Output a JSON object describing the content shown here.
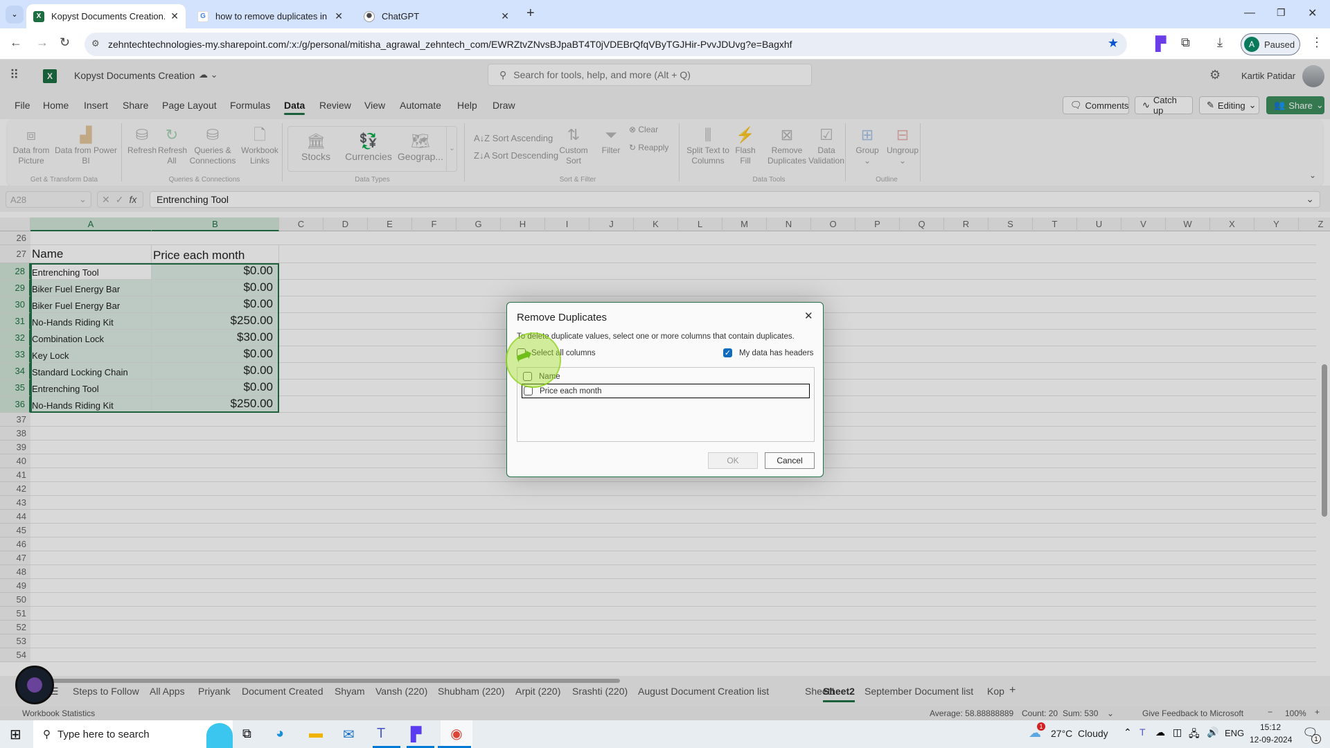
{
  "browser": {
    "tabs": [
      {
        "title": "Kopyst Documents Creation.xlsx",
        "icon": "excel-icon",
        "active": true
      },
      {
        "title": "how to remove duplicates in excel",
        "icon": "google-icon",
        "active": false
      },
      {
        "title": "ChatGPT",
        "icon": "chatgpt-icon",
        "active": false
      }
    ],
    "url": "zehntechtechnologies-my.sharepoint.com/:x:/g/personal/mitisha_agrawal_zehntech_com/EWRZtvZNvsBJpaBT4T0jVDEBrQfqVByTGJHir-PvvJDUvg?e=Bagxhf",
    "profile_label": "Paused",
    "profile_initial": "A"
  },
  "excel": {
    "doc_title": "Kopyst Documents Creation",
    "search_placeholder": "Search for tools, help, and more (Alt + Q)",
    "user_name": "Kartik Patidar",
    "menu": [
      "File",
      "Home",
      "Insert",
      "Share",
      "Page Layout",
      "Formulas",
      "Data",
      "Review",
      "View",
      "Automate",
      "Help",
      "Draw"
    ],
    "active_menu": "Data",
    "header_buttons": {
      "comments": "Comments",
      "catchup": "Catch up",
      "editing": "Editing",
      "share": "Share"
    },
    "ribbon": {
      "get_transform": {
        "label": "Get & Transform Data",
        "buttons": [
          "Data from Picture",
          "Data from Power BI"
        ]
      },
      "queries": {
        "label": "Queries & Connections",
        "buttons": [
          "Refresh",
          "Refresh All",
          "Queries & Connections",
          "Workbook Links"
        ]
      },
      "data_types": {
        "label": "Data Types",
        "buttons": [
          "Stocks",
          "Currencies",
          "Geograp..."
        ]
      },
      "sort_filter": {
        "label": "Sort & Filter",
        "sort_asc": "Sort Ascending",
        "sort_desc": "Sort Descending",
        "custom_sort": "Custom Sort",
        "filter": "Filter",
        "clear": "Clear",
        "reapply": "Reapply"
      },
      "data_tools": {
        "label": "Data Tools",
        "buttons": [
          "Split Text to Columns",
          "Flash Fill",
          "Remove Duplicates",
          "Data Validation"
        ]
      },
      "outline": {
        "label": "Outline",
        "buttons": [
          "Group",
          "Ungroup"
        ]
      }
    },
    "name_box": "A28",
    "formula_value": "Entrenching Tool",
    "columns": [
      "A",
      "B",
      "C",
      "D",
      "E",
      "F",
      "G",
      "H",
      "I",
      "J",
      "K",
      "L",
      "M",
      "N",
      "O",
      "P",
      "Q",
      "R",
      "S",
      "T",
      "U",
      "V",
      "W",
      "X",
      "Y",
      "Z"
    ],
    "header_row": {
      "row": "27",
      "a": "Name",
      "b": "Price each month"
    },
    "rows": [
      {
        "row": "28",
        "a": "Entrenching Tool",
        "b": "$0.00"
      },
      {
        "row": "29",
        "a": "Biker Fuel Energy Bar",
        "b": "$0.00"
      },
      {
        "row": "30",
        "a": "Biker Fuel Energy Bar",
        "b": "$0.00"
      },
      {
        "row": "31",
        "a": "No-Hands Riding Kit",
        "b": "$250.00"
      },
      {
        "row": "32",
        "a": "Combination Lock",
        "b": "$30.00"
      },
      {
        "row": "33",
        "a": "Key Lock",
        "b": "$0.00"
      },
      {
        "row": "34",
        "a": "Standard Locking Chain",
        "b": "$0.00"
      },
      {
        "row": "35",
        "a": "Entrenching Tool",
        "b": "$0.00"
      },
      {
        "row": "36",
        "a": "No-Hands Riding Kit",
        "b": "$250.00"
      }
    ],
    "empty_rows": [
      "26",
      "37",
      "38",
      "39",
      "40",
      "41",
      "42",
      "43",
      "44",
      "45",
      "46",
      "47",
      "48",
      "49",
      "50",
      "51",
      "52",
      "53",
      "54"
    ],
    "sheet_tabs": [
      "Steps to Follow",
      "All Apps",
      "Priyank",
      "Document Created",
      "Shyam",
      "Vansh (220)",
      "Shubham (220)",
      "Arpit (220)",
      "Srashti (220)",
      "August Document Creation list",
      "Sheet1",
      "Sheet2",
      "September Document list",
      "Kop"
    ],
    "active_sheet": "Sheet2",
    "status": {
      "workbook_stats": "Workbook Statistics",
      "average": "Average: 58.88888889",
      "count": "Count: 20",
      "sum": "Sum: 530",
      "feedback": "Give Feedback to Microsoft",
      "zoom": "100%"
    }
  },
  "dialog": {
    "title": "Remove Duplicates",
    "description": "To delete duplicate values, select one or more columns that contain duplicates.",
    "select_all_label": "Select all columns",
    "select_all_checked": false,
    "headers_label": "My data has headers",
    "headers_checked": true,
    "columns": [
      {
        "label": "Name",
        "checked": false
      },
      {
        "label": "Price each month",
        "checked": false
      }
    ],
    "ok_label": "OK",
    "cancel_label": "Cancel"
  },
  "taskbar": {
    "search_placeholder": "Type here to search",
    "weather": "27°C  Cloudy",
    "weather_badge": "1",
    "language": "ENG",
    "time": "15:12",
    "date": "12-09-2024",
    "notification_count": "1"
  }
}
